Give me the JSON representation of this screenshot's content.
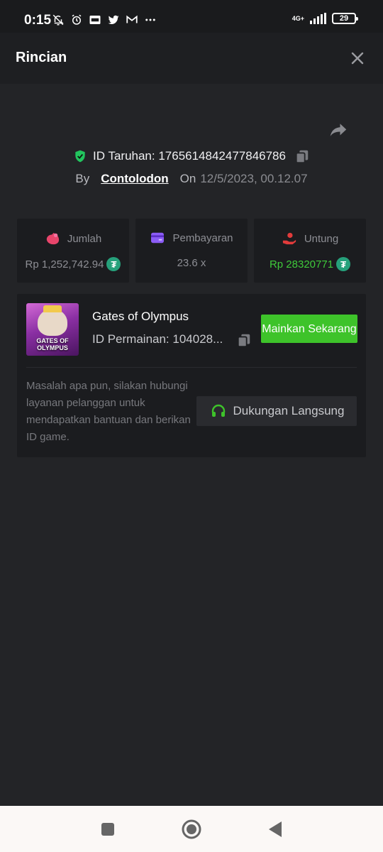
{
  "status_bar": {
    "time": "0:15",
    "network": "4G+",
    "battery": "29"
  },
  "header": {
    "title": "Rincian"
  },
  "bet": {
    "id_label": "ID Taruhan: 1765614842477846786",
    "by_label": "By",
    "username": "Contolodon",
    "on_label": "On",
    "date": "12/5/2023, 00.12.07"
  },
  "stats": {
    "amount": {
      "label": "Jumlah",
      "value": "Rp 1,252,742.94"
    },
    "payout": {
      "label": "Pembayaran",
      "value": "23.6 x"
    },
    "profit": {
      "label": "Untung",
      "value": "Rp 28320771"
    },
    "coin_symbol": "₮"
  },
  "game": {
    "name": "Gates of Olympus",
    "id_label": "ID Permainan: 104028...",
    "thumb_text": "GATES OF OLYMPUS",
    "play_label": "Mainkan Sekarang",
    "help_text": "Masalah apa pun, silakan hubungi layanan pelanggan untuk mendapatkan bantuan dan berikan ID game.",
    "support_label": "Dukungan Langsung"
  },
  "colors": {
    "background": "#232427",
    "accent_green": "#3ec32a",
    "profit_green": "#3fca3a",
    "coin_teal": "#26a17b",
    "amount_icon": "#e8456b",
    "payout_icon": "#8b5cf6",
    "profit_icon": "#e23b3b"
  },
  "icons": {
    "close": "close-icon",
    "share": "share-icon",
    "shield": "shield-check-icon",
    "copy": "copy-icon",
    "headset": "headset-icon"
  }
}
